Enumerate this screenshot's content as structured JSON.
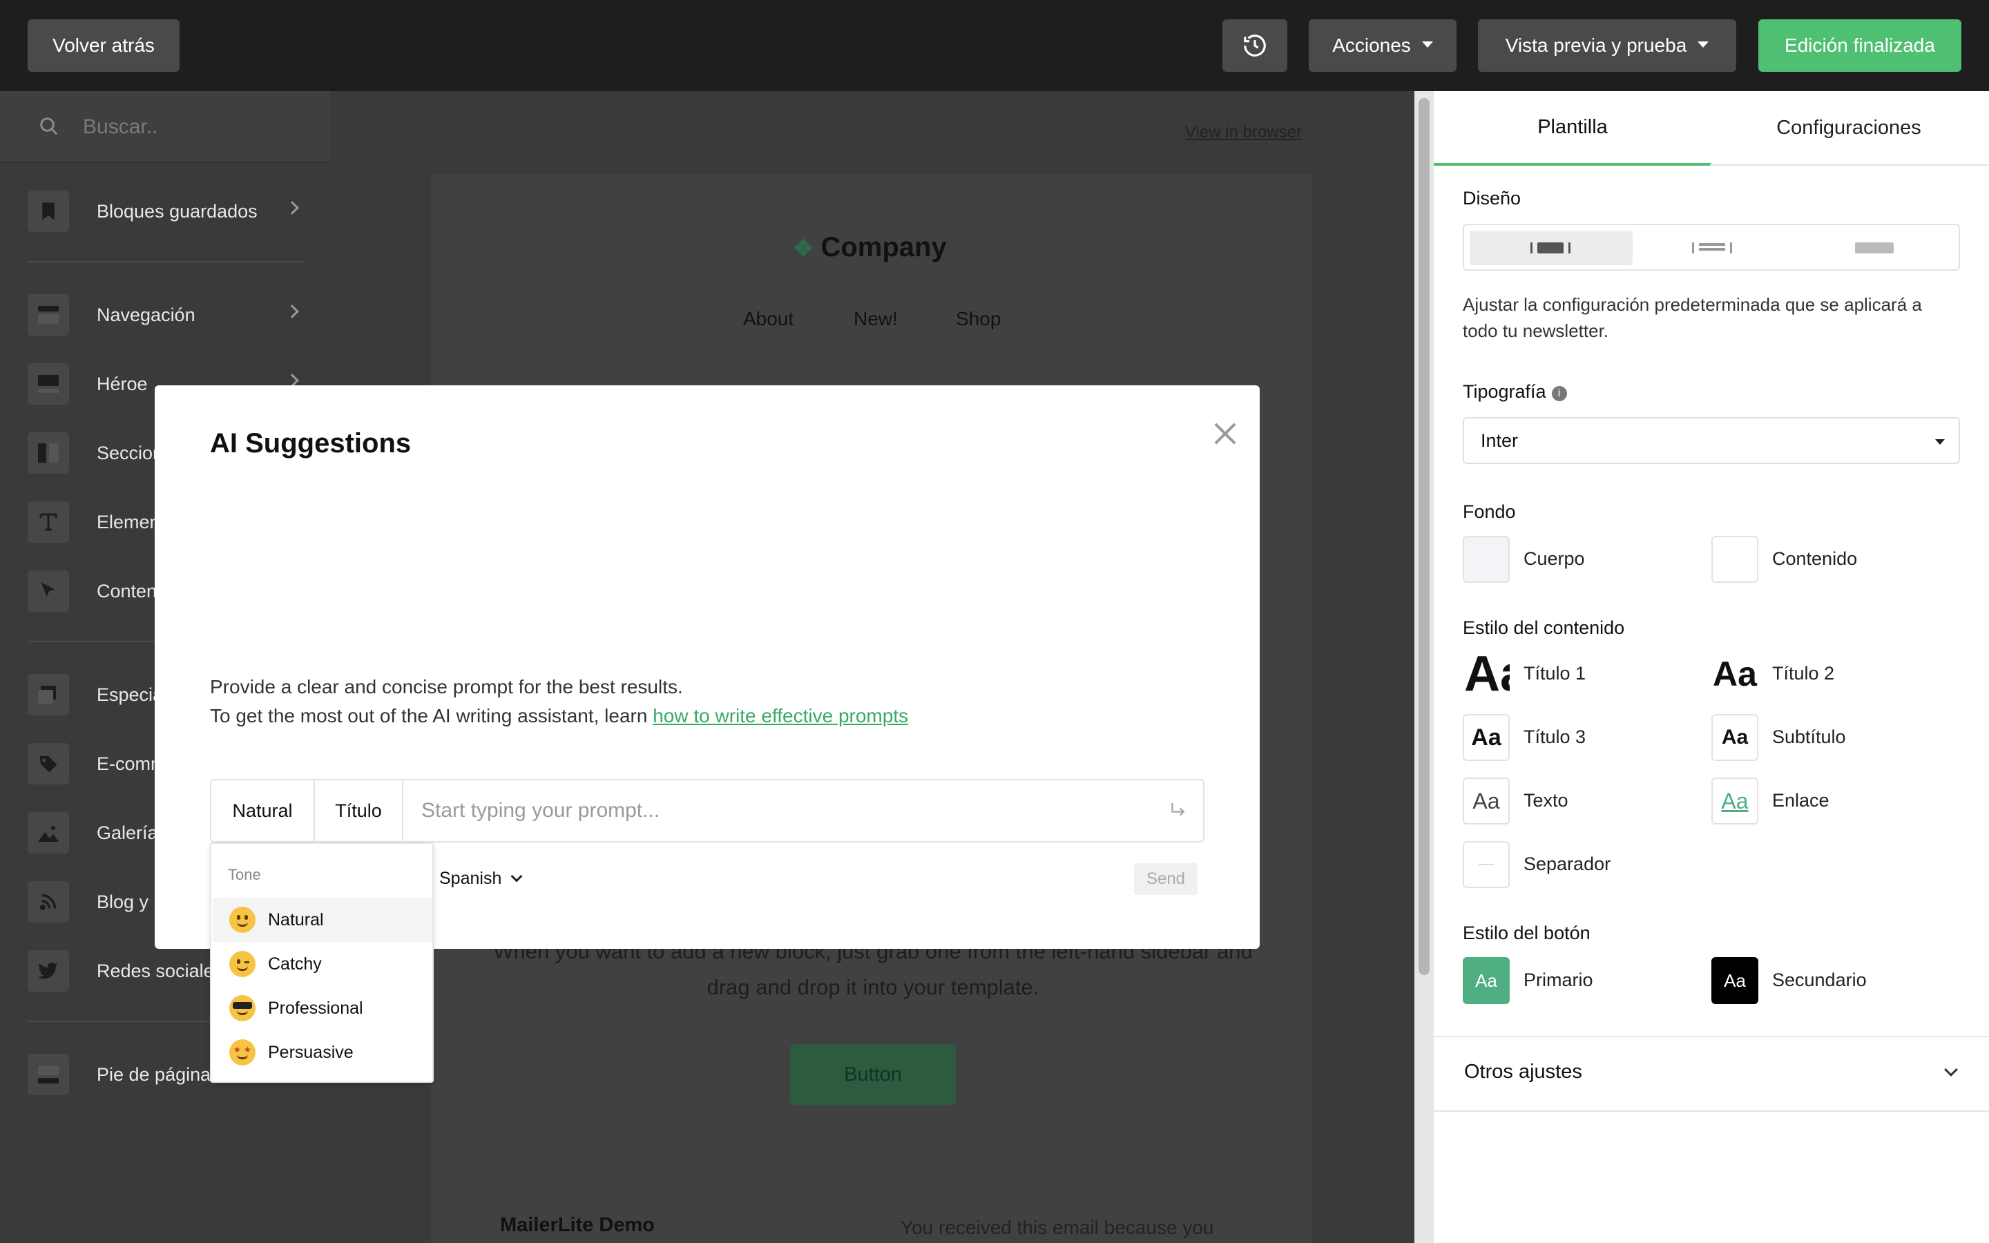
{
  "topbar": {
    "back": "Volver atrás",
    "history_icon": "history-icon",
    "actions": "Acciones",
    "preview": "Vista previa y prueba",
    "done": "Edición finalizada"
  },
  "sidebar": {
    "search_placeholder": "Buscar..",
    "items": [
      {
        "label": "Bloques guardados",
        "icon": "bookmark-icon"
      },
      {
        "label": "Navegación",
        "icon": "navigation-icon"
      },
      {
        "label": "Héroe",
        "icon": "hero-icon"
      },
      {
        "label": "Secciones",
        "icon": "columns-icon"
      },
      {
        "label": "Elementos",
        "icon": "text-icon"
      },
      {
        "label": "Contenido",
        "icon": "cursor-icon"
      },
      {
        "label": "Especial",
        "icon": "layers-icon"
      },
      {
        "label": "E-commerce",
        "icon": "tag-icon"
      },
      {
        "label": "Galería",
        "icon": "image-icon"
      },
      {
        "label": "Blog y RSS",
        "icon": "rss-icon"
      },
      {
        "label": "Redes sociales",
        "icon": "twitter-icon"
      },
      {
        "label": "Pie de página",
        "icon": "footer-icon"
      }
    ]
  },
  "canvas": {
    "view_in_browser": "View in browser",
    "company": "Company",
    "nav": [
      "About",
      "New!",
      "Shop"
    ],
    "body_text": "When you want to add a new block, just grab one from the left-hand sidebar and drag and drop it into your template.",
    "button": "Button",
    "footer_brand": "MailerLite Demo",
    "footer_note": "You received this email because you"
  },
  "panel": {
    "tabs": [
      "Plantilla",
      "Configuraciones"
    ],
    "design_label": "Diseño",
    "design_desc": "Ajustar la configuración predeterminada que se aplicará a todo tu newsletter.",
    "typography_label": "Tipografía",
    "typography_value": "Inter",
    "background_label": "Fondo",
    "background_body": "Cuerpo",
    "background_content": "Contenido",
    "content_style_label": "Estilo del contenido",
    "styles": [
      "Título 1",
      "Título 2",
      "Título 3",
      "Subtítulo",
      "Texto",
      "Enlace",
      "Separador"
    ],
    "swatch_text": "Aa",
    "button_style_label": "Estilo del botón",
    "primary": "Primario",
    "secondary": "Secundario",
    "other_settings": "Otros ajustes",
    "colors": {
      "accent": "#4fbf72",
      "primary_btn": "#4fae82",
      "secondary_btn": "#000000"
    }
  },
  "modal": {
    "title": "AI Suggestions",
    "help_line1": "Provide a clear and concise prompt for the best results.",
    "help_line2": "To get the most out of the AI writing assistant, learn ",
    "help_link": "how to write effective prompts",
    "tone_value": "Natural",
    "type_value": "Título",
    "prompt_placeholder": "Start typing your prompt...",
    "language": "Spanish",
    "send": "Send",
    "tone_menu": {
      "heading": "Tone",
      "options": [
        "Natural",
        "Catchy",
        "Professional",
        "Persuasive"
      ],
      "selected": "Natural"
    }
  }
}
